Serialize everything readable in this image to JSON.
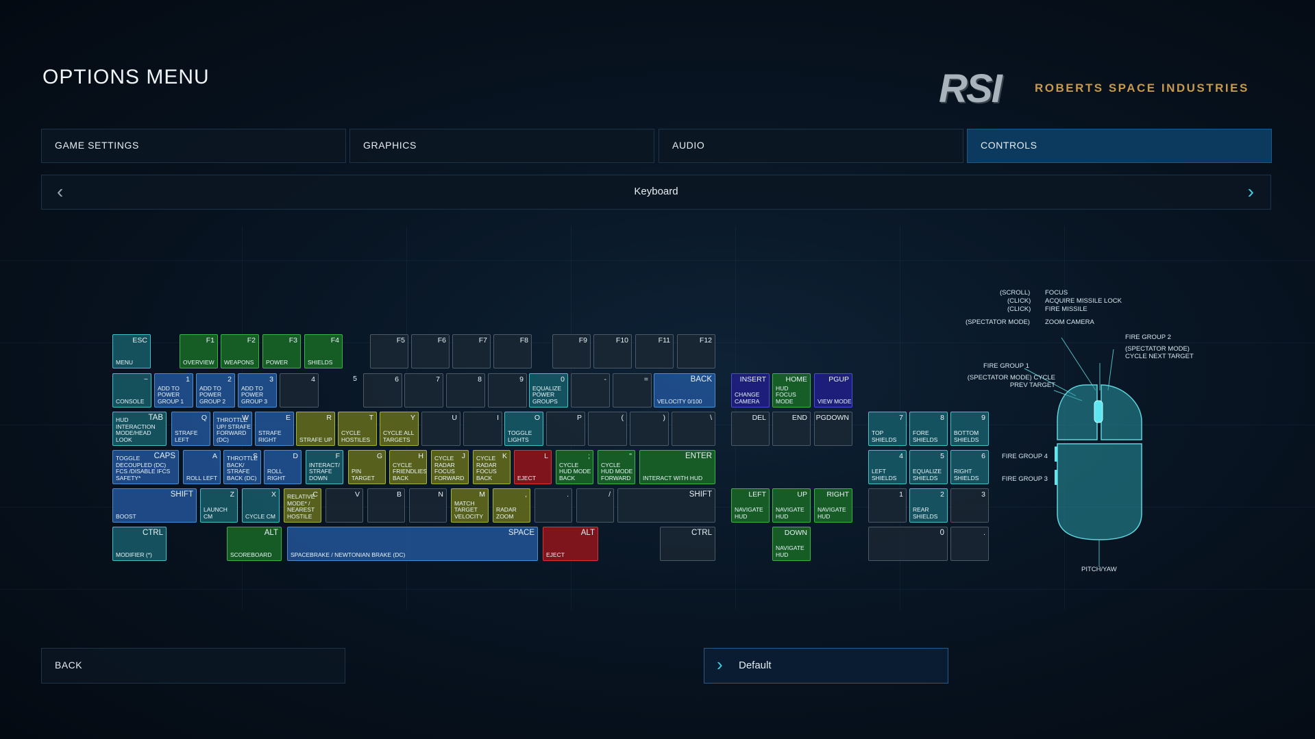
{
  "title": "OPTIONS MENU",
  "brand": {
    "mark": "RSI",
    "name": "ROBERTS SPACE INDUSTRIES",
    "accent": "#c79a4c"
  },
  "tabs": [
    {
      "label": "GAME SETTINGS",
      "active": false
    },
    {
      "label": "GRAPHICS",
      "active": false
    },
    {
      "label": "AUDIO",
      "active": false
    },
    {
      "label": "CONTROLS",
      "active": true
    }
  ],
  "device": {
    "label": "Keyboard",
    "prev_icon": "chevron-left-icon",
    "next_icon": "chevron-right-icon"
  },
  "colors": {
    "cyan": "#3fc4cc",
    "green": "#39b54a",
    "blue": "#4a8fd0",
    "olive": "#a8b432",
    "red": "#d8343c",
    "purple": "#4b4ed8"
  },
  "keys": [
    {
      "key": "ESC",
      "action": "MENU",
      "color": "cyan"
    },
    {
      "key": "F1",
      "action": "OVERVIEW",
      "color": "green"
    },
    {
      "key": "F2",
      "action": "WEAPONS",
      "color": "green"
    },
    {
      "key": "F3",
      "action": "POWER",
      "color": "green"
    },
    {
      "key": "F4",
      "action": "SHIELDS",
      "color": "green"
    },
    {
      "key": "F5",
      "action": "",
      "color": "none"
    },
    {
      "key": "F6",
      "action": "",
      "color": "none"
    },
    {
      "key": "F7",
      "action": "",
      "color": "none"
    },
    {
      "key": "F8",
      "action": "",
      "color": "none"
    },
    {
      "key": "F9",
      "action": "",
      "color": "none"
    },
    {
      "key": "F10",
      "action": "",
      "color": "none"
    },
    {
      "key": "F11",
      "action": "",
      "color": "none"
    },
    {
      "key": "F12",
      "action": "",
      "color": "none"
    },
    {
      "key": "~",
      "action": "CONSOLE",
      "color": "cyan"
    },
    {
      "key": "1",
      "action": "ADD TO POWER GROUP 1",
      "color": "blue"
    },
    {
      "key": "2",
      "action": "ADD TO POWER GROUP 2",
      "color": "blue"
    },
    {
      "key": "3",
      "action": "ADD TO POWER GROUP 3",
      "color": "blue"
    },
    {
      "key": "4",
      "action": "",
      "color": "none"
    },
    {
      "key": "5",
      "action": "",
      "color": "nobox"
    },
    {
      "key": "6",
      "action": "",
      "color": "none"
    },
    {
      "key": "7",
      "action": "",
      "color": "none"
    },
    {
      "key": "8",
      "action": "",
      "color": "none"
    },
    {
      "key": "9",
      "action": "",
      "color": "none"
    },
    {
      "key": "0",
      "action": "EQUALIZE POWER GROUPS",
      "color": "cyan"
    },
    {
      "key": "-",
      "action": "",
      "color": "none"
    },
    {
      "key": "=",
      "action": "",
      "color": "none"
    },
    {
      "key": "BACK",
      "action": "VELOCITY 0/100",
      "color": "blue"
    },
    {
      "key": "TAB",
      "action": "HUD INTERACTION MODE/HEAD LOOK",
      "color": "cyan"
    },
    {
      "key": "Q",
      "action": "STRAFE LEFT",
      "color": "blue"
    },
    {
      "key": "W",
      "action": "THROTTLE UP/ STRAFE FORWARD (DC)",
      "color": "blue"
    },
    {
      "key": "E",
      "action": "STRAFE RIGHT",
      "color": "blue"
    },
    {
      "key": "R",
      "action": "STRAFE UP",
      "color": "olive"
    },
    {
      "key": "T",
      "action": "CYCLE HOSTILES",
      "color": "olive"
    },
    {
      "key": "Y",
      "action": "CYCLE ALL TARGETS",
      "color": "olive"
    },
    {
      "key": "U",
      "action": "",
      "color": "none"
    },
    {
      "key": "I",
      "action": "",
      "color": "none"
    },
    {
      "key": "O",
      "action": "TOGGLE LIGHTS",
      "color": "cyan"
    },
    {
      "key": "P",
      "action": "",
      "color": "none"
    },
    {
      "key": "(",
      "action": "",
      "color": "none"
    },
    {
      "key": ")",
      "action": "",
      "color": "none"
    },
    {
      "key": "\\",
      "action": "",
      "color": "none"
    },
    {
      "key": "CAPS",
      "action": "TOGGLE DECOUPLED (DC) FCS /DISABLE IFCS SAFETY*",
      "color": "blue"
    },
    {
      "key": "A",
      "action": "ROLL LEFT",
      "color": "blue"
    },
    {
      "key": "S",
      "action": "THROTTLE BACK/ STRAFE BACK (DC)",
      "color": "blue"
    },
    {
      "key": "D",
      "action": "ROLL RIGHT",
      "color": "blue"
    },
    {
      "key": "F",
      "action": "INTERACT/ STRAFE DOWN",
      "color": "cyan"
    },
    {
      "key": "G",
      "action": "PIN TARGET",
      "color": "olive"
    },
    {
      "key": "H",
      "action": "CYCLE FRIENDLIES BACK",
      "color": "olive"
    },
    {
      "key": "J",
      "action": "CYCLE RADAR FOCUS FORWARD",
      "color": "olive"
    },
    {
      "key": "K",
      "action": "CYCLE RADAR FOCUS BACK",
      "color": "olive"
    },
    {
      "key": "L",
      "action": "EJECT",
      "color": "red"
    },
    {
      "key": ";",
      "action": "CYCLE HUD MODE BACK",
      "color": "green"
    },
    {
      "key": "\"",
      "action": "CYCLE HUD MODE FORWARD",
      "color": "green"
    },
    {
      "key": "ENTER",
      "action": "INTERACT WITH HUD",
      "color": "green"
    },
    {
      "key": "SHIFT",
      "action": "BOOST",
      "color": "blue"
    },
    {
      "key": "Z",
      "action": "LAUNCH CM",
      "color": "cyan"
    },
    {
      "key": "X",
      "action": "CYCLE CM",
      "color": "cyan"
    },
    {
      "key": "C",
      "action": "RELATIVE MODE* / NEAREST HOSTILE",
      "color": "olive"
    },
    {
      "key": "V",
      "action": "",
      "color": "none"
    },
    {
      "key": "B",
      "action": "",
      "color": "none"
    },
    {
      "key": "N",
      "action": "",
      "color": "none"
    },
    {
      "key": "M",
      "action": "MATCH TARGET VELOCITY",
      "color": "olive"
    },
    {
      "key": ",",
      "action": "RADAR ZOOM",
      "color": "olive"
    },
    {
      "key": ".",
      "action": "",
      "color": "none"
    },
    {
      "key": "/",
      "action": "",
      "color": "none"
    },
    {
      "key": "SHIFT",
      "action": "",
      "color": "none"
    },
    {
      "key": "CTRL",
      "action": "MODIFIER (*)",
      "color": "cyan"
    },
    {
      "key": "ALT",
      "action": "SCOREBOARD",
      "color": "green"
    },
    {
      "key": "SPACE",
      "action": "SPACEBRAKE / NEWTONIAN BRAKE (DC)",
      "color": "blue"
    },
    {
      "key": "ALT",
      "action": "EJECT",
      "color": "red"
    },
    {
      "key": "CTRL",
      "action": "",
      "color": "none"
    },
    {
      "key": "INSERT",
      "action": "CHANGE CAMERA",
      "color": "purple"
    },
    {
      "key": "HOME",
      "action": "HUD FOCUS MODE",
      "color": "green"
    },
    {
      "key": "PGUP",
      "action": "VIEW MODE",
      "color": "purple"
    },
    {
      "key": "DEL",
      "action": "",
      "color": "none"
    },
    {
      "key": "END",
      "action": "",
      "color": "none"
    },
    {
      "key": "PGDOWN",
      "action": "",
      "color": "none"
    },
    {
      "key": "LEFT",
      "action": "NAVIGATE HUD",
      "color": "green"
    },
    {
      "key": "UP",
      "action": "NAVIGATE HUD",
      "color": "green"
    },
    {
      "key": "RIGHT",
      "action": "NAVIGATE HUD",
      "color": "green"
    },
    {
      "key": "DOWN",
      "action": "NAVIGATE HUD",
      "color": "green"
    },
    {
      "key": "7",
      "action": "TOP SHIELDS",
      "color": "cyan"
    },
    {
      "key": "8",
      "action": "FORE SHIELDS",
      "color": "cyan"
    },
    {
      "key": "9",
      "action": "BOTTOM SHIELDS",
      "color": "cyan"
    },
    {
      "key": "4",
      "action": "LEFT SHIELDS",
      "color": "cyan"
    },
    {
      "key": "5",
      "action": "EQUALIZE SHIELDS",
      "color": "cyan"
    },
    {
      "key": "6",
      "action": "RIGHT SHIELDS",
      "color": "cyan"
    },
    {
      "key": "1",
      "action": "",
      "color": "none"
    },
    {
      "key": "2",
      "action": "REAR SHIELDS",
      "color": "cyan"
    },
    {
      "key": "3",
      "action": "",
      "color": "none"
    },
    {
      "key": "0",
      "action": "",
      "color": "none"
    },
    {
      "key": ".",
      "action": "",
      "color": "none"
    }
  ],
  "mouse": {
    "scroll_label": "(SCROLL)",
    "scroll_action": "FOCUS",
    "click1_label": "(CLICK)",
    "click1_action": "ACQUIRE MISSILE LOCK",
    "click2_label": "(CLICK)",
    "click2_action": "FIRE MISSILE",
    "spectator_label": "(SPECTATOR MODE)",
    "spectator_action": "ZOOM CAMERA",
    "fire_group_2": "FIRE GROUP 2",
    "fire_group_2_sub": "(SPECTATOR MODE) CYCLE NEXT TARGET",
    "fire_group_1": "FIRE GROUP 1",
    "fire_group_1_sub": "(SPECTATOR MODE) CYCLE PREV TARGET",
    "fire_group_4": "FIRE GROUP 4",
    "fire_group_3": "FIRE GROUP 3",
    "pitch_yaw": "PITCH/YAW"
  },
  "footer": {
    "back_label": "BACK",
    "default_label": "Default"
  }
}
